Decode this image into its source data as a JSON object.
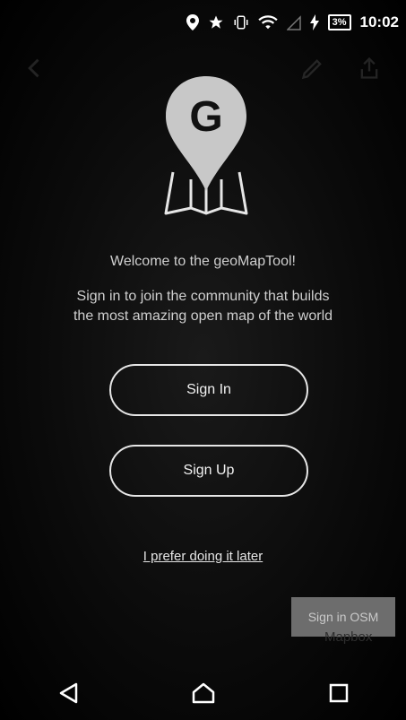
{
  "status_bar": {
    "battery": "3%",
    "time": "10:02",
    "icons": [
      "location-icon",
      "star-icon",
      "vibrate-icon",
      "wifi-icon",
      "signal-icon",
      "charging-icon",
      "battery-icon"
    ]
  },
  "toolbar": {
    "icons": [
      "back-icon",
      "edit-icon",
      "share-icon"
    ]
  },
  "onboarding": {
    "logo_letter": "G",
    "welcome": "Welcome to the geoMapTool!",
    "subtitle_line1": "Sign in to join the community that builds",
    "subtitle_line2": "the most amazing open map of the world",
    "sign_in_label": "Sign In",
    "sign_up_label": "Sign Up",
    "later_label": "I prefer doing it later"
  },
  "overlay": {
    "osm_button": "Sign in OSM",
    "attribution": "Mapbox"
  },
  "nav_bar": {
    "icons": [
      "nav-back-icon",
      "nav-home-icon",
      "nav-recents-icon"
    ]
  },
  "colors": {
    "background": "#000000",
    "button_border": "#e6e6e6",
    "logo_gray": "#c8c8c8"
  }
}
